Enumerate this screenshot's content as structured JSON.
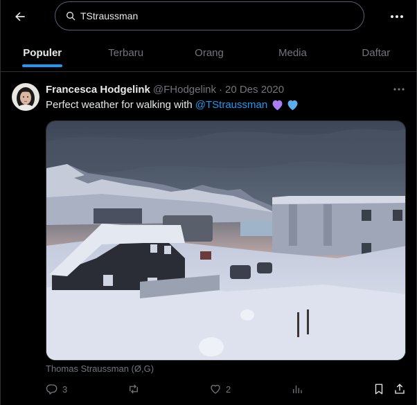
{
  "search": {
    "query": "TStraussman"
  },
  "tabs": [
    {
      "label": "Populer",
      "active": true
    },
    {
      "label": "Terbaru",
      "active": false
    },
    {
      "label": "Orang",
      "active": false
    },
    {
      "label": "Media",
      "active": false
    },
    {
      "label": "Daftar",
      "active": false
    }
  ],
  "tweet": {
    "author_name": "Francesca Hodgelink",
    "handle": "@FHodgelink",
    "separator": "·",
    "date": "20 Des 2020",
    "text": "Perfect weather for walking with",
    "mention": "@TStraussman",
    "emoji": [
      "purple-heart",
      "blue-heart"
    ],
    "media_caption": "Thomas Straussman (Ø,G)",
    "reply_count": "3",
    "retweet_count": "",
    "like_count": "2"
  },
  "colors": {
    "background": "#000000",
    "accent": "#1d9bf0",
    "text_primary": "#e7e9ea",
    "text_secondary": "#71767b",
    "border": "#2f3336",
    "purple_heart": "#ab7df8",
    "blue_heart": "#5dadec"
  }
}
